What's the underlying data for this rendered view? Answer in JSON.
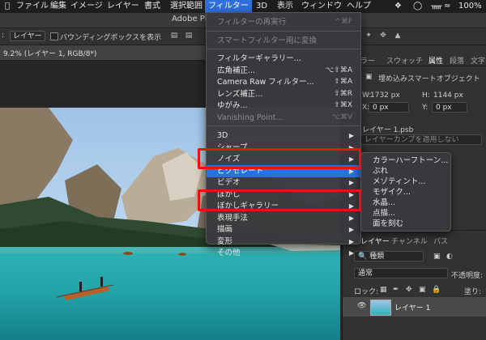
{
  "menubar": {
    "items": [
      "ファイル",
      "編集",
      "イメージ",
      "レイヤー",
      "書式",
      "選択範囲",
      "フィルター",
      "3D",
      "表示",
      "ウィンドウ",
      "ヘルプ"
    ],
    "battery": "100%",
    "icons": [
      "apple-icon",
      "dropbox-icon",
      "ring-icon",
      "bluetooth-icon",
      "wifi-icon",
      "battery-icon"
    ]
  },
  "window_title": "Adobe Ph",
  "options": {
    "layer_select": "レイヤー",
    "bbox_label": "バウンディングボックスを表示",
    "prefix": ":"
  },
  "doc_tab": "9.2% (レイヤー 1, RGB/8*)",
  "filter_menu": {
    "items": [
      {
        "label": "フィルターの再実行",
        "shortcut": "^⌘F",
        "state": "disabled"
      },
      {
        "type": "sep"
      },
      {
        "label": "スマートフィルター用に変換",
        "shortcut": "",
        "state": "disabled"
      },
      {
        "type": "sep"
      },
      {
        "label": "フィルターギャラリー...",
        "shortcut": ""
      },
      {
        "label": "広角補正...",
        "shortcut": "⌥⇧⌘A"
      },
      {
        "label": "Camera Raw フィルター...",
        "shortcut": "⇧⌘A"
      },
      {
        "label": "レンズ補正...",
        "shortcut": "⇧⌘R"
      },
      {
        "label": "ゆがみ...",
        "shortcut": "⇧⌘X"
      },
      {
        "label": "Vanishing Point...",
        "shortcut": "⌥⌘V",
        "state": "disabled"
      },
      {
        "type": "sep"
      },
      {
        "label": "3D",
        "submenu": true
      },
      {
        "label": "シャープ",
        "submenu": true
      },
      {
        "label": "ノイズ",
        "submenu": true
      },
      {
        "label": "ピクセレート",
        "submenu": true,
        "state": "selected"
      },
      {
        "label": "ビデオ",
        "submenu": true
      },
      {
        "label": "ぼかし",
        "submenu": true
      },
      {
        "label": "ぼかしギャラリー",
        "submenu": true
      },
      {
        "label": "表現手法",
        "submenu": true
      },
      {
        "label": "描画",
        "submenu": true
      },
      {
        "label": "変形",
        "submenu": true
      },
      {
        "label": "その他",
        "submenu": true
      }
    ]
  },
  "pixelate_submenu": [
    "カラーハーフトーン...",
    "ぶれ",
    "メゾティント...",
    "モザイク...",
    "水晶...",
    "点描...",
    "面を刻む"
  ],
  "right_panel": {
    "top_tabs": [
      "ラー",
      "スウォッチ",
      "属性",
      "段落",
      "文字"
    ],
    "properties_title": "埋め込みスマートオブジェクト",
    "w_label": "W:",
    "w_value": "1732 px",
    "h_label": "H:",
    "h_value": "1144 px",
    "x_label": "X:",
    "x_value": "0 px",
    "y_label": "Y:",
    "y_value": "0 px",
    "file_name": "レイヤー 1.psb",
    "comp_placeholder": "レイヤーカンプを適用しない",
    "layer_tabs": [
      "レイヤー",
      "チャンネル",
      "パス"
    ],
    "kind_label": "種類",
    "blend_mode": "通常",
    "opacity_label": "不透明度:",
    "lock_label": "ロック:",
    "fill_label": "塗り:",
    "layer_name": "レイヤー 1"
  },
  "colors": {
    "menu_highlight": "#2f6fdc",
    "annotation_red": "#ee1010"
  }
}
